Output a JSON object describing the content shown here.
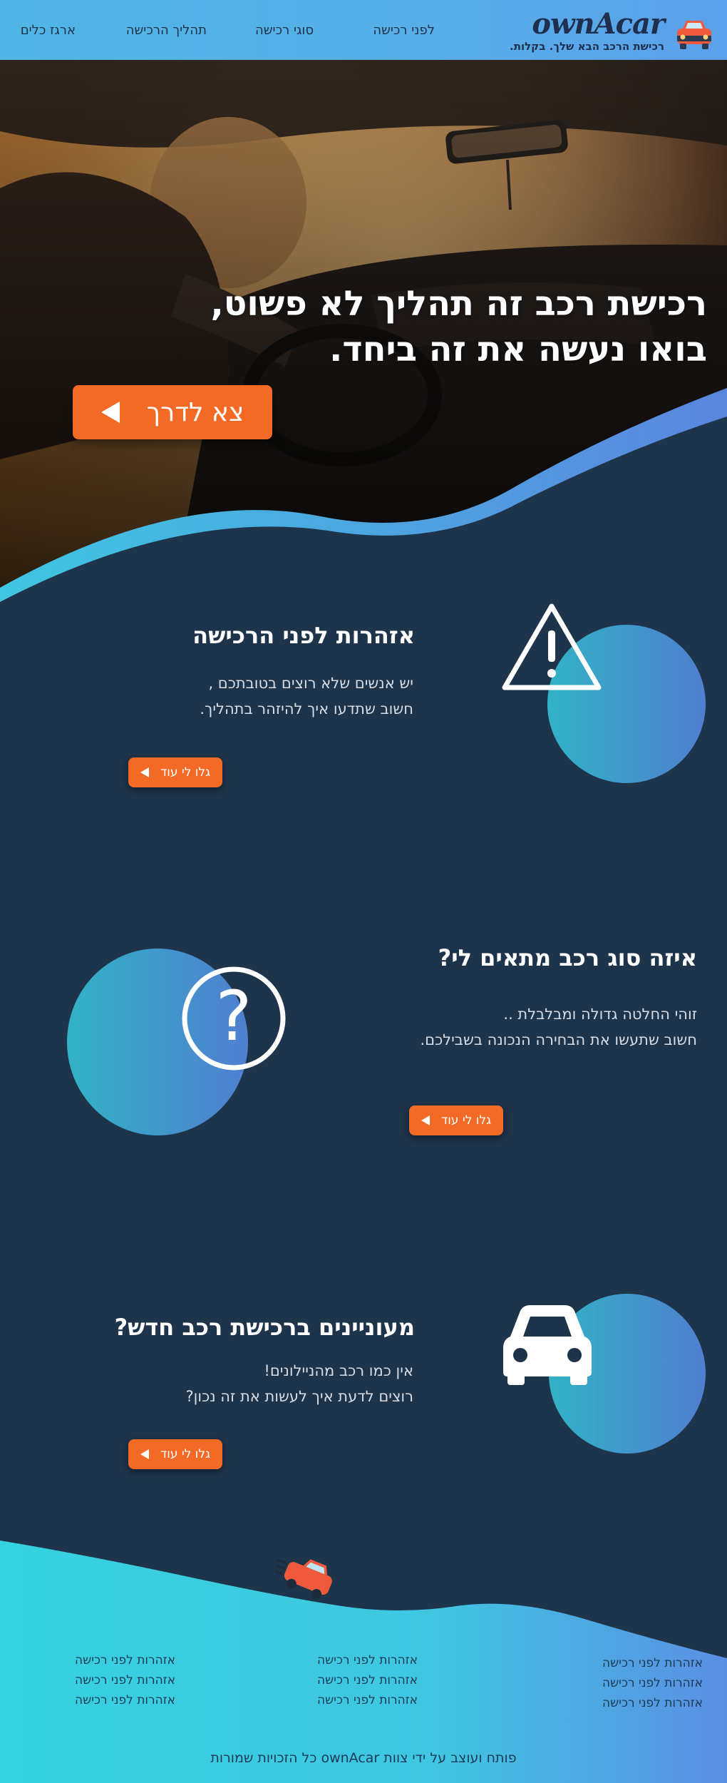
{
  "header": {
    "logo": "ownAcar",
    "tagline": "רכישת הרכב הבא שלך. בקלות.",
    "nav": [
      "לפני רכישה",
      "סוגי רכישה",
      "תהליך הרכישה",
      "ארגז כלים"
    ]
  },
  "hero": {
    "title_line1": "רכישת רכב זה תהליך לא פשוט,",
    "title_line2": "בואו נעשה את זה ביחד.",
    "cta": "צא לדרך"
  },
  "sections": [
    {
      "icon": "warning-icon",
      "title": "אזהרות לפני הרכישה",
      "line1": "יש אנשים שלא רוצים בטובתכם ,",
      "line2": "חשוב שתדעו איך להיזהר בתהליך.",
      "button": "גלו לי עוד"
    },
    {
      "icon": "question-mark-icon",
      "title": "איזה סוג רכב מתאים לי?",
      "line1": "זוהי החלטה גדולה ומבלבלת ..",
      "line2": "חשוב שתעשו את הבחירה הנכונה בשבילכם.",
      "button": "גלו לי עוד"
    },
    {
      "icon": "car-icon",
      "title": "מעוניינים ברכישת רכב חדש?",
      "line1": "אין כמו רכב מהניילונים!",
      "line2": "רוצים לדעת איך לעשות את זה נכון?",
      "button": "גלו לי עוד"
    }
  ],
  "footer": {
    "columns": [
      [
        "אזהרות לפני רכישה",
        "אזהרות לפני רכישה",
        "אזהרות לפני רכישה"
      ],
      [
        "אזהרות לפני רכישה",
        "אזהרות לפני רכישה",
        "אזהרות לפני רכישה"
      ],
      [
        "אזהרות לפני רכישה",
        "אזהרות לפני רכישה",
        "אזהרות לפני רכישה"
      ]
    ],
    "copyright": "פותח ועוצב על ידי צוות ownAcar כל הזכויות שמורות"
  },
  "colors": {
    "accent_orange": "#f26a25",
    "navy_background": "#1e344a",
    "header_blue": "#4fb6e6",
    "footer_cyan": "#3ad0e0",
    "circle_teal": "#31b2c6",
    "circle_blue": "#4f7fd0"
  }
}
